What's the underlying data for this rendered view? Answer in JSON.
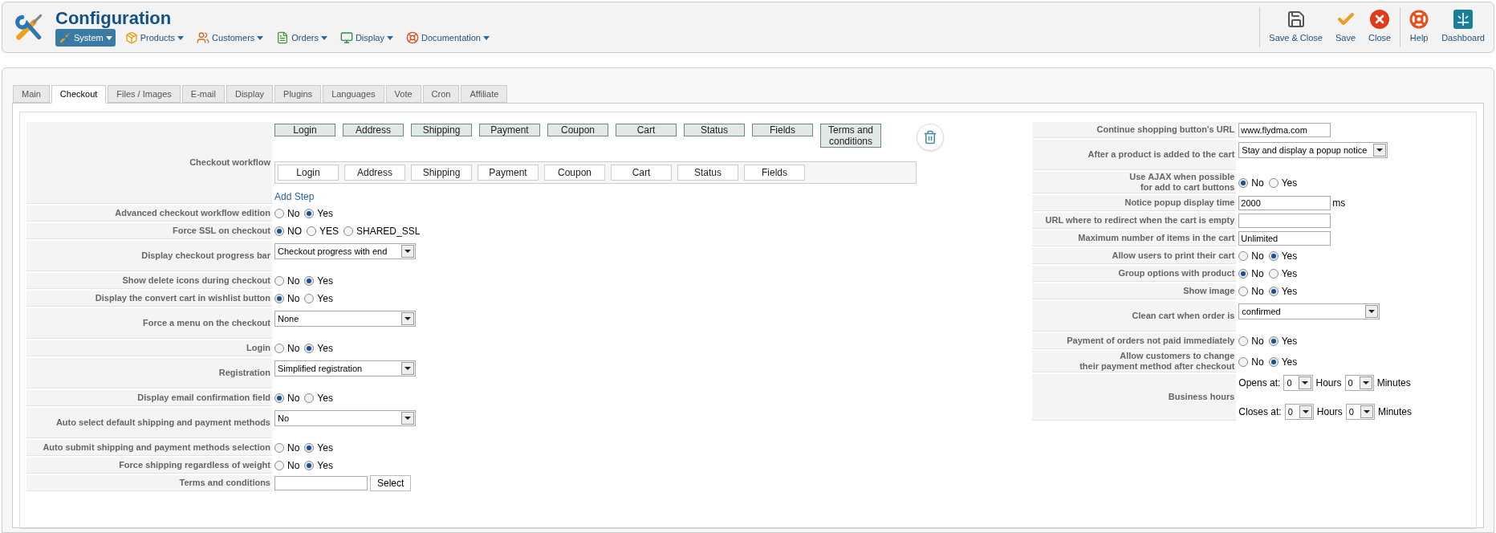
{
  "header": {
    "title": "Configuration"
  },
  "menu": [
    {
      "label": "System",
      "kind": "system",
      "selected": true
    },
    {
      "label": "Products",
      "kind": "products",
      "selected": false
    },
    {
      "label": "Customers",
      "kind": "customers",
      "selected": false
    },
    {
      "label": "Orders",
      "kind": "orders",
      "selected": false
    },
    {
      "label": "Display",
      "kind": "display",
      "selected": false
    },
    {
      "label": "Documentation",
      "kind": "documentation",
      "selected": false
    }
  ],
  "toolbar": [
    [
      {
        "label": "Save & Close",
        "kind": "save_close"
      },
      {
        "label": "Save",
        "kind": "save"
      },
      {
        "label": "Close",
        "kind": "close"
      }
    ],
    [
      {
        "label": "Help",
        "kind": "help"
      },
      {
        "label": "Dashboard",
        "kind": "dashboard"
      }
    ]
  ],
  "tabs": [
    {
      "label": "Main",
      "selected": false
    },
    {
      "label": "Checkout",
      "selected": true
    },
    {
      "label": "Files / Images",
      "selected": false
    },
    {
      "label": "E-mail",
      "selected": false
    },
    {
      "label": "Display",
      "selected": false
    },
    {
      "label": "Plugins",
      "selected": false
    },
    {
      "label": "Languages",
      "selected": false
    },
    {
      "label": "Vote",
      "selected": false
    },
    {
      "label": "Cron",
      "selected": false
    },
    {
      "label": "Affiliate",
      "selected": false
    }
  ],
  "left": {
    "rows": [
      {
        "kind": "workflow",
        "label": "Checkout workflow",
        "steps": [
          "Login",
          "Address",
          "Shipping",
          "Payment",
          "Coupon",
          "Cart",
          "Status",
          "Fields",
          "Terms and\nconditions"
        ],
        "available": [
          "Login",
          "Address",
          "Shipping",
          "Payment",
          "Coupon",
          "Cart",
          "Status",
          "Fields"
        ],
        "link": "Add Step"
      },
      {
        "kind": "radio",
        "label": "Advanced checkout workflow edition",
        "options": [
          {
            "label": "No",
            "selected": false
          },
          {
            "label": "Yes",
            "selected": true
          }
        ]
      },
      {
        "kind": "radio",
        "label": "Force SSL on checkout",
        "options": [
          {
            "label": "NO",
            "selected": true
          },
          {
            "label": "YES",
            "selected": false
          },
          {
            "label": "SHARED_SSL",
            "selected": false
          }
        ]
      },
      {
        "kind": "select",
        "label": "Display checkout progress bar",
        "value": "Checkout progress with end"
      },
      {
        "kind": "radio",
        "label": "Show delete icons during checkout",
        "options": [
          {
            "label": "No",
            "selected": false
          },
          {
            "label": "Yes",
            "selected": true
          }
        ]
      },
      {
        "kind": "radio",
        "label": "Display the convert cart in wishlist button",
        "options": [
          {
            "label": "No",
            "selected": true
          },
          {
            "label": "Yes",
            "selected": false
          }
        ]
      },
      {
        "kind": "select",
        "label": "Force a menu on the checkout",
        "value": "None"
      },
      {
        "kind": "radio",
        "label": "Login",
        "options": [
          {
            "label": "No",
            "selected": false
          },
          {
            "label": "Yes",
            "selected": true
          }
        ]
      },
      {
        "kind": "select",
        "label": "Registration",
        "value": "Simplified registration"
      },
      {
        "kind": "radio",
        "label": "Display email confirmation field",
        "options": [
          {
            "label": "No",
            "selected": true
          },
          {
            "label": "Yes",
            "selected": false
          }
        ]
      },
      {
        "kind": "select",
        "label": "Auto select default shipping and payment methods",
        "value": "No"
      },
      {
        "kind": "radio",
        "label": "Auto submit shipping and payment methods selection",
        "options": [
          {
            "label": "No",
            "selected": false
          },
          {
            "label": "Yes",
            "selected": true
          }
        ]
      },
      {
        "kind": "radio",
        "label": "Force shipping regardless of weight",
        "options": [
          {
            "label": "No",
            "selected": false
          },
          {
            "label": "Yes",
            "selected": true
          }
        ]
      },
      {
        "kind": "picker",
        "label": "Terms and conditions",
        "button": "Select"
      }
    ]
  },
  "right": {
    "rows": [
      {
        "kind": "text",
        "label": "Continue shopping button's URL",
        "value": "www.flydma.com"
      },
      {
        "kind": "select",
        "label": "After a product is added to the cart",
        "value": "Stay and display a popup notice"
      },
      {
        "kind": "radio",
        "label": "Use AJAX when possible\nfor add to cart buttons",
        "options": [
          {
            "label": "No",
            "selected": true
          },
          {
            "label": "Yes",
            "selected": false
          }
        ]
      },
      {
        "kind": "text",
        "label": "Notice popup display time",
        "value": "2000",
        "suffix": "ms"
      },
      {
        "kind": "text",
        "label": "URL where to redirect when the cart is empty"
      },
      {
        "kind": "text",
        "label": "Maximum number of items in the cart",
        "value": "Unlimited"
      },
      {
        "kind": "radio",
        "label": "Allow users to print their cart",
        "options": [
          {
            "label": "No",
            "selected": false
          },
          {
            "label": "Yes",
            "selected": true
          }
        ]
      },
      {
        "kind": "radio",
        "label": "Group options with product",
        "options": [
          {
            "label": "No",
            "selected": true
          },
          {
            "label": "Yes",
            "selected": false
          }
        ]
      },
      {
        "kind": "radio",
        "label": "Show image",
        "options": [
          {
            "label": "No",
            "selected": false
          },
          {
            "label": "Yes",
            "selected": true
          }
        ]
      },
      {
        "kind": "select",
        "label": "Clean cart when order is",
        "value": "confirmed"
      },
      {
        "kind": "radio",
        "label": "Payment of orders not paid immediately",
        "options": [
          {
            "label": "No",
            "selected": false
          },
          {
            "label": "Yes",
            "selected": true
          }
        ]
      },
      {
        "kind": "radio",
        "label": "Allow customers to change\ntheir payment method after checkout",
        "options": [
          {
            "label": "No",
            "selected": false
          },
          {
            "label": "Yes",
            "selected": true
          }
        ]
      },
      {
        "kind": "hours",
        "label": "Business hours",
        "lines": [
          {
            "prefix": "Opens at:",
            "hours": "0",
            "hours_label": "Hours",
            "minutes": "0",
            "minutes_label": "Minutes"
          },
          {
            "prefix": "Closes at:",
            "hours": "0",
            "hours_label": "Hours",
            "minutes": "0",
            "minutes_label": "Minutes"
          }
        ]
      }
    ]
  }
}
